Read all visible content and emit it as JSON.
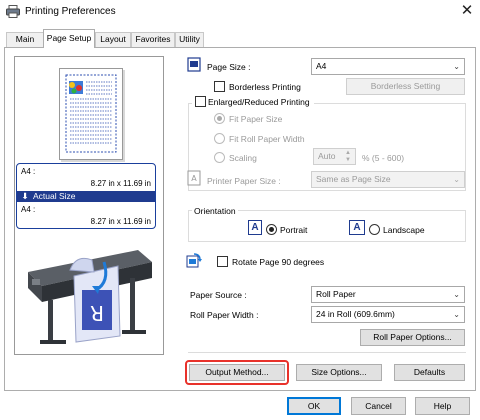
{
  "window": {
    "title": "Printing Preferences"
  },
  "tabs": [
    {
      "label": "Main"
    },
    {
      "label": "Page Setup"
    },
    {
      "label": "Layout"
    },
    {
      "label": "Favorites"
    },
    {
      "label": "Utility"
    }
  ],
  "preview": {
    "original_size": "A4 :",
    "original_dims": "8.27 in x 11.69 in",
    "actual_label": "Actual Size",
    "output_size": "A4 :",
    "output_dims": "8.27 in x 11.69 in",
    "sheet_letter": "R"
  },
  "page_size": {
    "label": "Page Size :",
    "value": "A4"
  },
  "borderless": {
    "label": "Borderless Printing",
    "button": "Borderless Setting"
  },
  "enlarged": {
    "label": "Enlarged/Reduced Printing",
    "fit_paper": "Fit Paper Size",
    "fit_roll": "Fit Roll Paper Width",
    "scaling": "Scaling",
    "scaling_value": "Auto",
    "scaling_unit": "% (5 - 600)"
  },
  "printer_paper_size": {
    "label": "Printer Paper Size :",
    "value": "Same as Page Size"
  },
  "orientation": {
    "label": "Orientation",
    "portrait": "Portrait",
    "landscape": "Landscape",
    "icon_letter": "A"
  },
  "rotate": {
    "label": "Rotate Page 90 degrees"
  },
  "paper_source": {
    "label": "Paper Source :",
    "value": "Roll Paper"
  },
  "roll_width": {
    "label": "Roll Paper Width :",
    "value": "24 in Roll (609.6mm)"
  },
  "buttons": {
    "roll_options": "Roll Paper Options...",
    "output_method": "Output Method...",
    "size_options": "Size Options...",
    "defaults": "Defaults",
    "ok": "OK",
    "cancel": "Cancel",
    "help": "Help"
  },
  "colors": {
    "accent_blue": "#1f3b8f",
    "highlight_red": "#e8322b"
  }
}
